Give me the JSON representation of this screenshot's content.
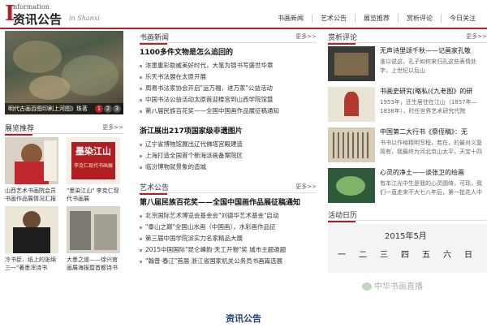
{
  "header": {
    "logo_first_letter": "I",
    "logo_superscript": "nformation",
    "logo_title": "资讯公告",
    "logo_subtitle": "in Shanxi",
    "nav": [
      "书画新闻",
      "艺术公告",
      "展览推荐",
      "赏析评论",
      "今日关注"
    ]
  },
  "left": {
    "hero_caption": "明代古画百图印刷上河图》珠茗",
    "hero_pages": [
      "1",
      "2",
      "3"
    ],
    "section_title": "展览推荐",
    "section_more": "更多>>",
    "thumbs": [
      {
        "caption": "山西艺术书画院会员书画作品展情况汇报表"
      },
      {
        "caption": "\"墨染江山\" 李克仁现代书画展",
        "poster_title": "墨染江山",
        "poster_sub": "李克仁现代书画展"
      },
      {
        "caption": "冷书臣、纸上的张绵三一\"著墨浑诗书"
      },
      {
        "caption": "大墨之道——徐兴官画展海报暨首都诗书"
      }
    ]
  },
  "middle": {
    "news_title": "书画新闻",
    "news_more": "更多>>",
    "headline1": "1100多件文物是怎么追回的",
    "list1": [
      "浓墨重彩助威美好时代，大笔为锦书写盛世华章",
      "乐天书法展在太原开展",
      "周易书法家协会开启\"运万福，进万家\"公益活动",
      "中国书法公益活动太原首迎楼宫到山西学院馆暨",
      "第八届民族百花奖——全国中国画作品展征稿通知"
    ],
    "headline2": "浙江展出217项国家级非遗图片",
    "list2": [
      "辽宁省博物馆展出辽代佛塔宫殿建造",
      "上海打造全国首个新海派画备案院区",
      "临汾博物就景象的造城"
    ],
    "notice_title": "艺术公告",
    "notice_more": "更多>>",
    "headline3": "第八届民族百花奖——全国中国画作品展征稿通知",
    "list3": [
      "北京国际艺术博览会基金会\"刘德华艺术基金\"启动",
      "\"泰山之巅\"全国山水画（中国画），水彩画作品征",
      "第三届中国学院派实力名家精品大展",
      "2015中国国际\"昆仑峰韵·天工开物\"奖 城市主题邀题",
      "\"翰普·春江\"首届 浙江省国家机关公务员书画篇选展"
    ]
  },
  "right": {
    "section_title": "赏析评论",
    "section_more": "更多>>",
    "items": [
      {
        "title": "无声诗里颂千秋——记画家孔敬",
        "desc": "谁以说这，孔子如何来归孔这些表情处字，上世纪以后山"
      },
      {
        "title": "书画史研究(略私(《九老图》的研",
        "desc": "1953年，还生居住在江山（1857年—1838年），时任世界艺术研究代院"
      },
      {
        "title": "中国第二大行书《祭侄稿》：无",
        "desc": "书书以作格精明写程，若在，的最对义复简有，我最终为河北京山太平，天宝十四年（755"
      },
      {
        "title": "心灵的净土——谈张卫的绘画",
        "desc": "有本江光中生是我的心灵圆绮，可现，我们一直走来不大七八年后，第一批花人中央美术学"
      }
    ],
    "calendar_title": "活动日历",
    "calendar_month": "2015年5月",
    "calendar_days": [
      "一",
      "二",
      "三",
      "四",
      "五",
      "六",
      "日"
    ],
    "watermark": "中华书画直播"
  },
  "footer_title": "资讯公告"
}
